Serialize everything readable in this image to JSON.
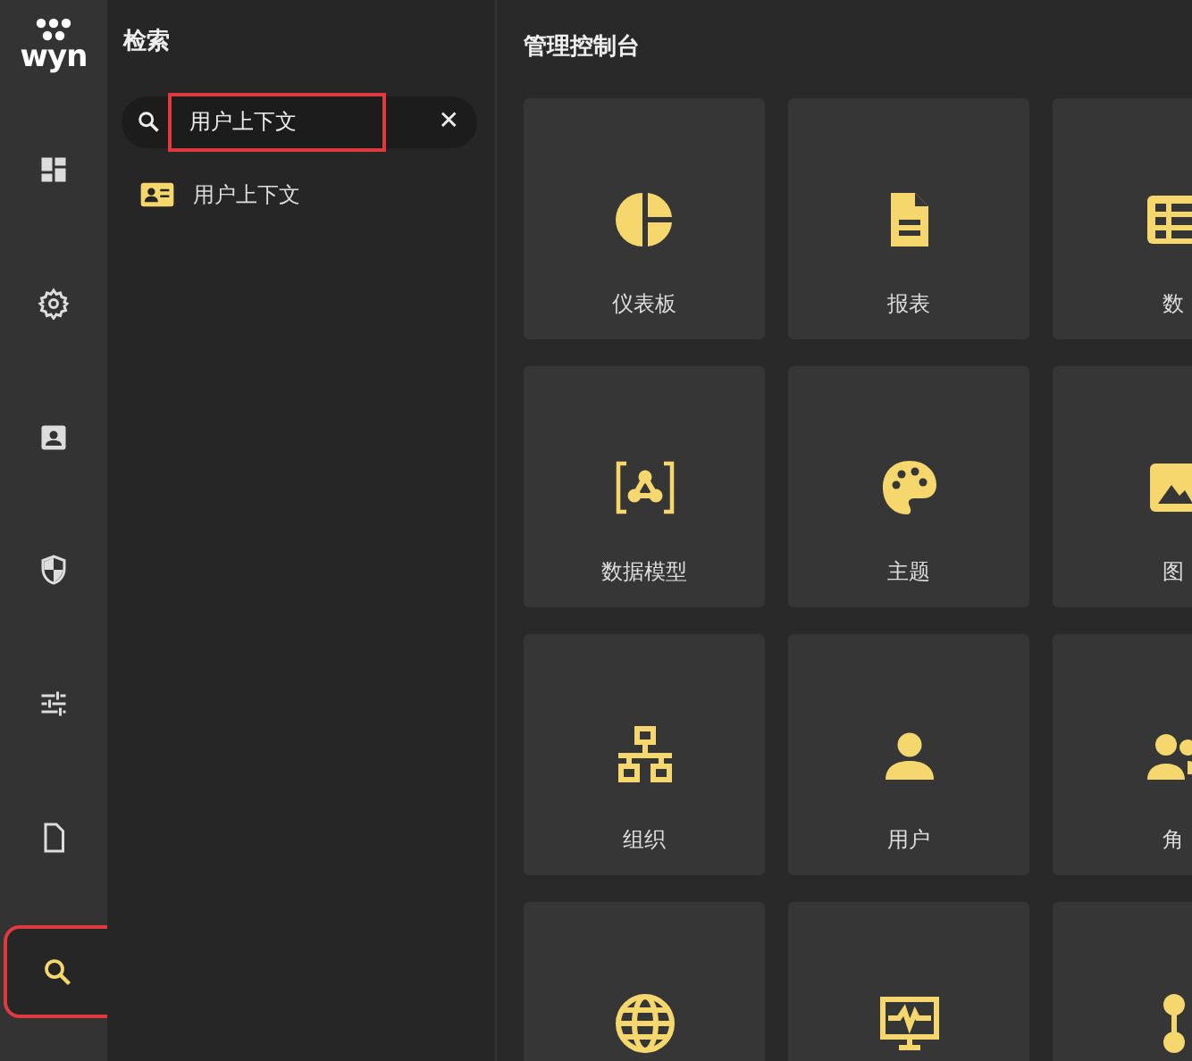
{
  "nav": {
    "logo": "wyn",
    "items": [
      {
        "selected": false,
        "highlighted": false
      },
      {
        "selected": false,
        "highlighted": false
      },
      {
        "selected": false,
        "highlighted": false
      },
      {
        "selected": false,
        "highlighted": false
      },
      {
        "selected": false,
        "highlighted": false
      },
      {
        "selected": false,
        "highlighted": false
      },
      {
        "selected": true,
        "highlighted": true
      }
    ]
  },
  "search_panel": {
    "title": "检索",
    "field": {
      "value": "用户上下文",
      "highlighted": true,
      "clear": "✕"
    },
    "results": [
      {
        "label": "用户上下文"
      }
    ]
  },
  "console": {
    "title": "管理控制台",
    "tiles": [
      {
        "label": "仪表板"
      },
      {
        "label": "报表"
      },
      {
        "label": "数"
      },
      {
        "label": "数据模型"
      },
      {
        "label": "主题"
      },
      {
        "label": "图"
      },
      {
        "label": "组织"
      },
      {
        "label": "用户"
      },
      {
        "label": "角"
      }
    ]
  }
}
